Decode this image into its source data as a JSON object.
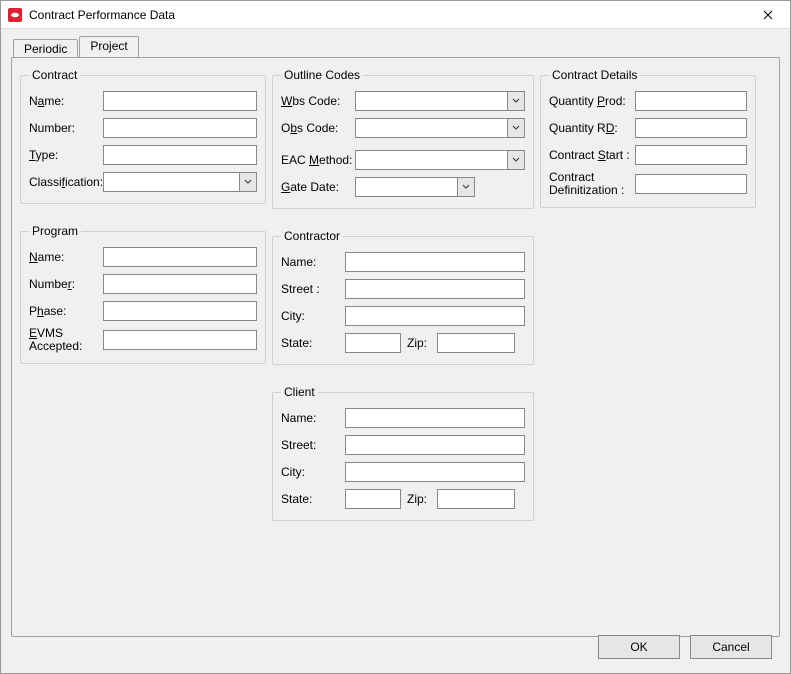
{
  "window": {
    "title": "Contract Performance Data"
  },
  "tabs": {
    "periodic": "Periodic",
    "project": "Project",
    "active": "project"
  },
  "groups": {
    "contract": {
      "legend": "Contract",
      "name_label_pre": "N",
      "name_label_u": "a",
      "name_label_post": "me:",
      "name_value": "",
      "number_label": "Number:",
      "number_value": "",
      "type_label_u": "T",
      "type_label_post": "ype:",
      "type_value": "",
      "class_label": "Classi",
      "class_label_u": "f",
      "class_label_post": "ication:",
      "class_value": ""
    },
    "outline": {
      "legend": "Outline Codes",
      "wbs_label_u": "W",
      "wbs_label_post": "bs Code:",
      "wbs_value": "",
      "obs_label_pre": "O",
      "obs_label_u": "b",
      "obs_label_post": "s Code:",
      "obs_value": "",
      "eac_label_pre": "EAC ",
      "eac_label_u": "M",
      "eac_label_post": "ethod:",
      "eac_value": "",
      "gate_label_u": "G",
      "gate_label_post": "ate Date:",
      "gate_value": ""
    },
    "details": {
      "legend": "Contract Details",
      "qprod_label_pre": "Quantity ",
      "qprod_label_u": "P",
      "qprod_label_post": "rod:",
      "qprod_value": "",
      "qrd_label_pre": "Quantity R",
      "qrd_label_u": "D",
      "qrd_label_post": ":",
      "qrd_value": "",
      "cstart_label_pre": "Contract ",
      "cstart_label_u": "S",
      "cstart_label_post": "tart :",
      "cstart_value": "",
      "cdef_label_pre": "Contract\nDe",
      "cdef_label_u": "",
      "cdef_label_post": "finitization :",
      "cdef_value": ""
    },
    "program": {
      "legend": "Program",
      "name_label_u": "N",
      "name_label_post": "ame:",
      "name_value": "",
      "number_label_pre": "Numbe",
      "number_label_u": "r",
      "number_label_post": ":",
      "number_value": "",
      "phase_label_pre": "P",
      "phase_label_u": "h",
      "phase_label_post": "ase:",
      "phase_value": "",
      "evms_label_u": "E",
      "evms_label_post": "VMS\nAccepted:",
      "evms_value": ""
    },
    "contractor": {
      "legend": "Contractor",
      "name_label": "Name:",
      "name_value": "",
      "street_label": "Street :",
      "street_value": "",
      "city_label": "City:",
      "city_value": "",
      "state_label": "State:",
      "state_value": "",
      "zip_label": "Zip:",
      "zip_value": ""
    },
    "client": {
      "legend": "Client",
      "name_label": "Name:",
      "name_value": "",
      "street_label": "Street:",
      "street_value": "",
      "city_label": "City:",
      "city_value": "",
      "state_label": "State:",
      "state_value": "",
      "zip_label": "Zip:",
      "zip_value": ""
    }
  },
  "buttons": {
    "ok": "OK",
    "cancel": "Cancel"
  }
}
